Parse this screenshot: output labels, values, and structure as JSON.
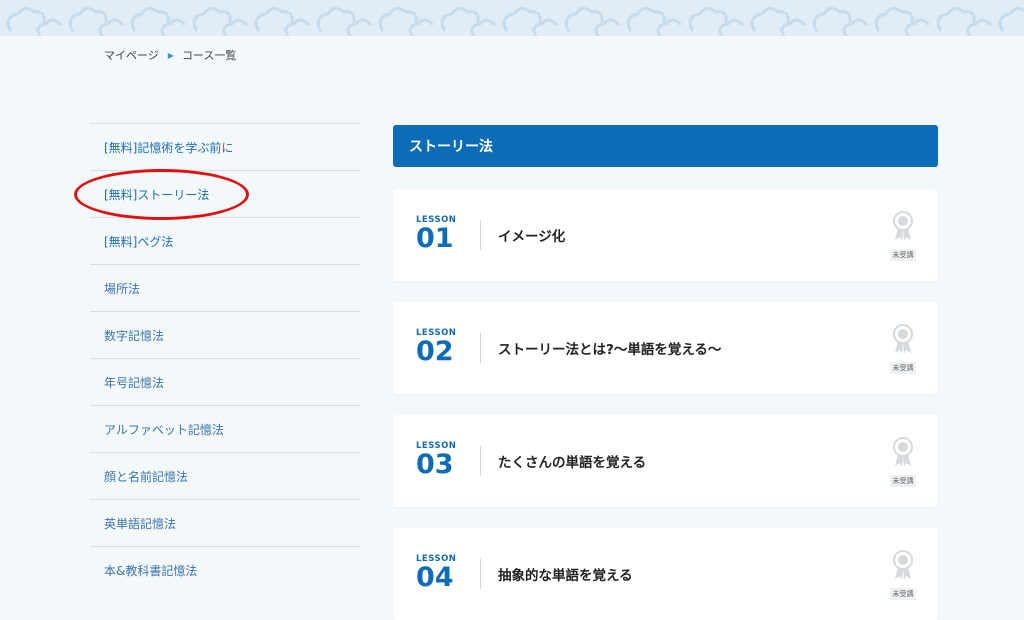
{
  "breadcrumb": {
    "home": "マイページ",
    "current": "コース一覧"
  },
  "sidebar": {
    "items": [
      {
        "label": "[無料]記憶術を学ぶ前に"
      },
      {
        "label": "[無料]ストーリー法"
      },
      {
        "label": "[無料]ペグ法"
      },
      {
        "label": "場所法"
      },
      {
        "label": "数字記憶法"
      },
      {
        "label": "年号記憶法"
      },
      {
        "label": "アルファベット記憶法"
      },
      {
        "label": "顔と名前記憶法"
      },
      {
        "label": "英単語記憶法"
      },
      {
        "label": "本&教科書記憶法"
      }
    ]
  },
  "course": {
    "title": "ストーリー法",
    "accent_color": "#0c6cb6",
    "highlight_color": "#e10f0f",
    "lessons": [
      {
        "lesson_label": "LESSON",
        "number": "01",
        "title": "イメージ化",
        "status": "未受講",
        "status_icon": "ribbon-badge-icon"
      },
      {
        "lesson_label": "LESSON",
        "number": "02",
        "title": "ストーリー法とは?〜単語を覚える〜",
        "status": "未受講",
        "status_icon": "ribbon-badge-icon"
      },
      {
        "lesson_label": "LESSON",
        "number": "03",
        "title": "たくさんの単語を覚える",
        "status": "未受講",
        "status_icon": "ribbon-badge-icon"
      },
      {
        "lesson_label": "LESSON",
        "number": "04",
        "title": "抽象的な単語を覚える",
        "status": "未受講",
        "status_icon": "ribbon-badge-icon"
      }
    ]
  }
}
